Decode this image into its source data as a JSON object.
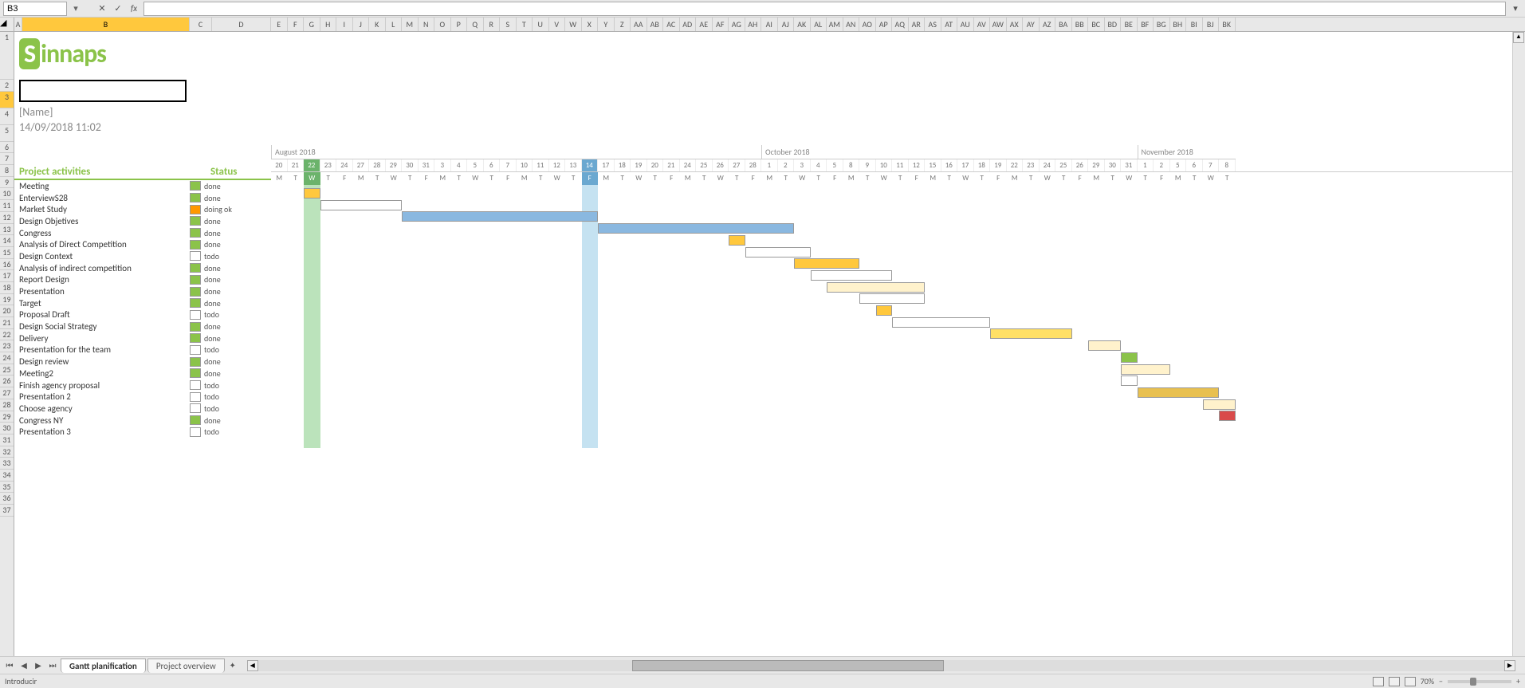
{
  "formula_bar": {
    "cell_ref": "B3",
    "formula": ""
  },
  "columns_left": [
    "A",
    "B",
    "C",
    "D"
  ],
  "columns_gantt": [
    "E",
    "F",
    "G",
    "H",
    "I",
    "J",
    "K",
    "L",
    "M",
    "N",
    "O",
    "P",
    "Q",
    "R",
    "S",
    "T",
    "U",
    "V",
    "W",
    "X",
    "Y",
    "Z",
    "AA",
    "AB",
    "AC",
    "AD",
    "AE",
    "AF",
    "AG",
    "AH",
    "AI",
    "AJ",
    "AK",
    "AL",
    "AM",
    "AN",
    "AO",
    "AP",
    "AQ",
    "AR",
    "AS",
    "AT",
    "AU",
    "AV",
    "AW",
    "AX",
    "AY",
    "AZ",
    "BA",
    "BB",
    "BC",
    "BD",
    "BE",
    "BF",
    "BG",
    "BH",
    "BI",
    "BJ",
    "BK"
  ],
  "selected_col": "B",
  "row_numbers": [
    1,
    2,
    3,
    4,
    5,
    6,
    7,
    8,
    9,
    10,
    11,
    12,
    13,
    14,
    15,
    16,
    17,
    18,
    19,
    20,
    21,
    22,
    23,
    24,
    25,
    26,
    27,
    28,
    29,
    30,
    31,
    32,
    33,
    34,
    35,
    36,
    37
  ],
  "selected_row": 3,
  "logo": "Sinnaps",
  "name_label": "[Name]",
  "date_label": "14/09/2018 11:02",
  "headers": {
    "activities": "Project activities",
    "status": "Status"
  },
  "activities": [
    {
      "name": "Meeting",
      "status": "done",
      "chip": "done"
    },
    {
      "name": "EnterviewS28",
      "status": "done",
      "chip": "done"
    },
    {
      "name": "Market Study",
      "status": "doing ok",
      "chip": "doing"
    },
    {
      "name": "Design Objetives",
      "status": "done",
      "chip": "done"
    },
    {
      "name": "Congress",
      "status": "done",
      "chip": "done"
    },
    {
      "name": "Analysis of Direct Competition",
      "status": "done",
      "chip": "done"
    },
    {
      "name": "Design Context",
      "status": "todo",
      "chip": "todo"
    },
    {
      "name": "Analysis of indirect competition",
      "status": "done",
      "chip": "done"
    },
    {
      "name": "Report Design",
      "status": "done",
      "chip": "done"
    },
    {
      "name": "Presentation",
      "status": "done",
      "chip": "done"
    },
    {
      "name": "Target",
      "status": "done",
      "chip": "done"
    },
    {
      "name": "Proposal Draft",
      "status": "todo",
      "chip": "todo"
    },
    {
      "name": "Design Social Strategy",
      "status": "done",
      "chip": "done"
    },
    {
      "name": "Delivery",
      "status": "done",
      "chip": "done"
    },
    {
      "name": "Presentation for the team",
      "status": "todo",
      "chip": "todo"
    },
    {
      "name": "Design review",
      "status": "done",
      "chip": "done"
    },
    {
      "name": "Meeting2",
      "status": "done",
      "chip": "done"
    },
    {
      "name": "Finish agency proposal",
      "status": "todo",
      "chip": "todo"
    },
    {
      "name": "Presentation 2",
      "status": "todo",
      "chip": "todo"
    },
    {
      "name": "Choose agency",
      "status": "todo",
      "chip": "todo"
    },
    {
      "name": "Congress NY",
      "status": "done",
      "chip": "done"
    },
    {
      "name": "Presentation 3",
      "status": "todo",
      "chip": "todo"
    }
  ],
  "gantt": {
    "months": [
      {
        "label": "August 2018",
        "span": 30
      },
      {
        "label": "October 2018",
        "span": 23
      },
      {
        "label": "November 2018",
        "span": 6
      }
    ],
    "days": [
      "20",
      "21",
      "22",
      "23",
      "24",
      "27",
      "28",
      "29",
      "30",
      "31",
      "3",
      "4",
      "5",
      "6",
      "7",
      "10",
      "11",
      "12",
      "13",
      "14",
      "17",
      "18",
      "19",
      "20",
      "21",
      "24",
      "25",
      "26",
      "27",
      "28",
      "1",
      "2",
      "3",
      "4",
      "5",
      "8",
      "9",
      "10",
      "11",
      "12",
      "15",
      "16",
      "17",
      "18",
      "19",
      "22",
      "23",
      "24",
      "25",
      "26",
      "29",
      "30",
      "31",
      "1",
      "2",
      "5",
      "6",
      "7",
      "8"
    ],
    "dow": [
      "M",
      "T",
      "W",
      "T",
      "F",
      "M",
      "T",
      "W",
      "T",
      "F",
      "M",
      "T",
      "W",
      "T",
      "F",
      "M",
      "T",
      "W",
      "T",
      "F",
      "M",
      "T",
      "W",
      "T",
      "F",
      "M",
      "T",
      "W",
      "T",
      "F",
      "M",
      "T",
      "W",
      "T",
      "F",
      "M",
      "T",
      "W",
      "T",
      "F",
      "M",
      "T",
      "W",
      "T",
      "F",
      "M",
      "T",
      "W",
      "T",
      "F",
      "M",
      "T",
      "W",
      "T",
      "F",
      "M",
      "T",
      "W",
      "T"
    ],
    "today_index": 2,
    "highlight_index": 19,
    "bars": [
      {
        "row": 0,
        "start": 2,
        "span": 1,
        "cls": "bar-orange"
      },
      {
        "row": 1,
        "start": 3,
        "span": 5,
        "cls": "bar-white"
      },
      {
        "row": 2,
        "start": 8,
        "span": 12,
        "cls": "bar-blue"
      },
      {
        "row": 3,
        "start": 20,
        "span": 12,
        "cls": "bar-blue"
      },
      {
        "row": 4,
        "start": 28,
        "span": 1,
        "cls": "bar-orange"
      },
      {
        "row": 5,
        "start": 29,
        "span": 4,
        "cls": "bar-white"
      },
      {
        "row": 6,
        "start": 32,
        "span": 4,
        "cls": "bar-orange"
      },
      {
        "row": 7,
        "start": 33,
        "span": 5,
        "cls": "bar-white"
      },
      {
        "row": 8,
        "start": 34,
        "span": 6,
        "cls": "bar-lightyellow"
      },
      {
        "row": 9,
        "start": 36,
        "span": 4,
        "cls": "bar-white"
      },
      {
        "row": 10,
        "start": 37,
        "span": 1,
        "cls": "bar-orange"
      },
      {
        "row": 11,
        "start": 38,
        "span": 6,
        "cls": "bar-white"
      },
      {
        "row": 12,
        "start": 44,
        "span": 5,
        "cls": "bar-yellow"
      },
      {
        "row": 13,
        "start": 50,
        "span": 2,
        "cls": "bar-lightyellow"
      },
      {
        "row": 14,
        "start": 52,
        "span": 1,
        "cls": "bar-green"
      },
      {
        "row": 15,
        "start": 52,
        "span": 3,
        "cls": "bar-lightyellow"
      },
      {
        "row": 16,
        "start": 52,
        "span": 1,
        "cls": "bar-white"
      },
      {
        "row": 17,
        "start": 53,
        "span": 5,
        "cls": "bar-dkyellow"
      },
      {
        "row": 18,
        "start": 57,
        "span": 2,
        "cls": "bar-lightyellow"
      },
      {
        "row": 19,
        "start": 58,
        "span": 1,
        "cls": "bar-red"
      }
    ]
  },
  "tabs": {
    "active": "Gantt planification",
    "other": "Project overview"
  },
  "status_bar": {
    "mode": "Introducir",
    "zoom": "70%"
  }
}
